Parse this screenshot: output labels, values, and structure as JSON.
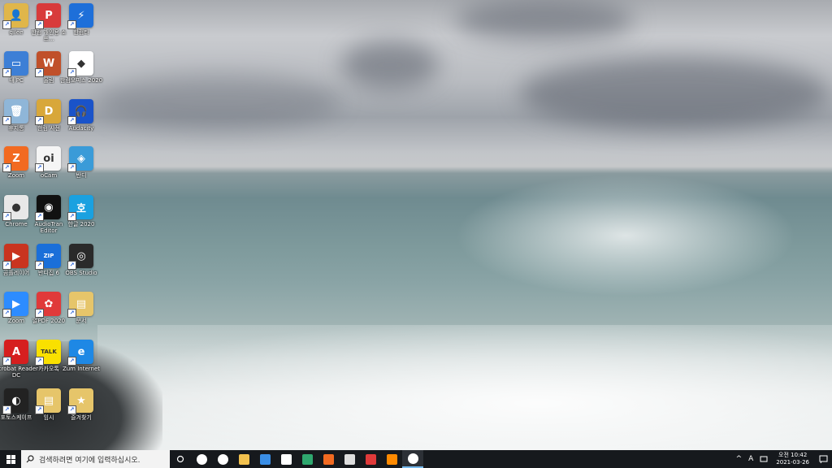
{
  "desktop": {
    "icons": [
      {
        "label": "gilee",
        "color": "#e0b64a",
        "glyph": "👤"
      },
      {
        "label": "한컴 개인용 소프...",
        "color": "#d83b3b",
        "glyph": "P"
      },
      {
        "label": "한컴타",
        "color": "#1e6fd9",
        "glyph": "⚡"
      },
      {
        "label": "내 PC",
        "color": "#3d7fd6",
        "glyph": "▭"
      },
      {
        "label": "울림",
        "color": "#c0502a",
        "glyph": "W"
      },
      {
        "label": "한컴오피스 2020",
        "color": "#ffffff",
        "glyph": "◆"
      },
      {
        "label": "휴지통",
        "color": "#8fb6d8",
        "glyph": "🗑"
      },
      {
        "label": "한컴 사전",
        "color": "#d8a73a",
        "glyph": "D"
      },
      {
        "label": "Audacity",
        "color": "#1a53c9",
        "glyph": "🎧"
      },
      {
        "label": "Zoom",
        "color": "#f26a21",
        "glyph": "Z"
      },
      {
        "label": "oCam",
        "color": "#f5f5f5",
        "glyph": "oi"
      },
      {
        "label": "반디",
        "color": "#3a9bd8",
        "glyph": "◈"
      },
      {
        "label": "Chrome",
        "color": "#e8e8e8",
        "glyph": "●"
      },
      {
        "label": "AudioTran Editor",
        "color": "#111111",
        "glyph": "◉"
      },
      {
        "label": "한글 2020",
        "color": "#1aa1e0",
        "glyph": "호"
      },
      {
        "label": "곰플레이어",
        "color": "#c9341f",
        "glyph": "▶"
      },
      {
        "label": "반디집 6",
        "color": "#1a6fd9",
        "glyph": "ZIP"
      },
      {
        "label": "OBS Studio",
        "color": "#2a2a2a",
        "glyph": "◎"
      },
      {
        "label": "Zoom",
        "color": "#2d8cff",
        "glyph": "▶"
      },
      {
        "label": "알PDF 2020",
        "color": "#e03a3a",
        "glyph": "✿"
      },
      {
        "label": "문서",
        "color": "#e6c56a",
        "glyph": "▤"
      },
      {
        "label": "Acrobat Reader DC",
        "color": "#d61f1f",
        "glyph": "A"
      },
      {
        "label": "카카오톡",
        "color": "#f9e000",
        "glyph": "TALK"
      },
      {
        "label": "Zum Internet",
        "color": "#1e88e5",
        "glyph": "e"
      },
      {
        "label": "포토스케이프",
        "color": "#222222",
        "glyph": "◐"
      },
      {
        "label": "임시",
        "color": "#e6c56a",
        "glyph": "▤"
      },
      {
        "label": "즐겨찾기",
        "color": "#e6c56a",
        "glyph": "★"
      }
    ]
  },
  "taskbar": {
    "search_placeholder": "검색하려면 여기에 입력하십시오.",
    "apps": [
      {
        "name": "task-view",
        "color": "#ffffff"
      },
      {
        "name": "media-player",
        "color": "#ffffff"
      },
      {
        "name": "file-explorer",
        "color": "#f2c14e"
      },
      {
        "name": "mail",
        "color": "#3a8ee6"
      },
      {
        "name": "store",
        "color": "#ffffff"
      },
      {
        "name": "edge",
        "color": "#2fa86f"
      },
      {
        "name": "zoom-z",
        "color": "#f26a21"
      },
      {
        "name": "movie-maker",
        "color": "#dddddd"
      },
      {
        "name": "capture",
        "color": "#e03a3a"
      },
      {
        "name": "firefox",
        "color": "#ff8a00"
      },
      {
        "name": "settings",
        "color": "#ffffff"
      }
    ],
    "tray": {
      "chevron": "^",
      "ime": "A",
      "time": "오전 10:42",
      "date": "2021-03-26"
    }
  }
}
